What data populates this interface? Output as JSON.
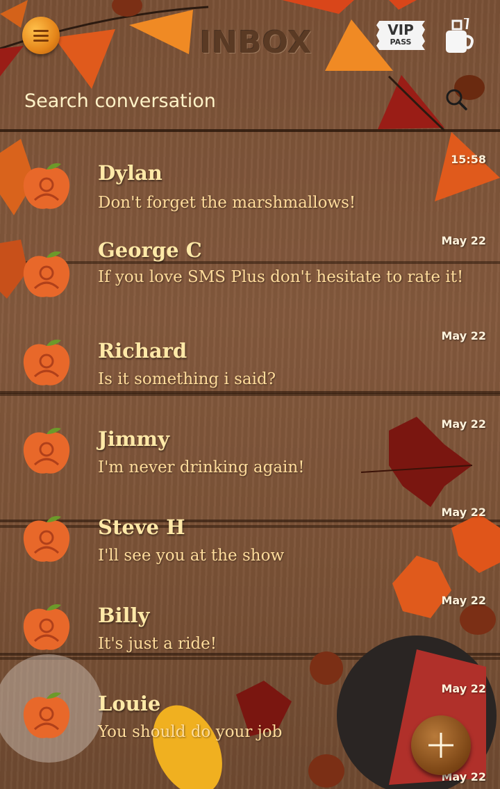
{
  "header": {
    "title": "INBOX",
    "vip_top": "VIP",
    "vip_bottom": "PASS",
    "search_placeholder": "Search conversation"
  },
  "icons": {
    "menu": "menu-icon",
    "vip": "vip-pass-icon",
    "theme": "coffee-cup-icon",
    "search": "search-icon",
    "compose": "plus-icon"
  },
  "colors": {
    "name": "#ffe9a8",
    "message": "#ffdc9c",
    "accent": "#e5861a",
    "wood": "#7a5136"
  },
  "conversations": [
    {
      "name": "Dylan",
      "message": "Don't forget the marshmallows!",
      "time": "15:58"
    },
    {
      "name": "George C",
      "message": "If you love SMS Plus don't hesitate to rate it!",
      "time": "May 22"
    },
    {
      "name": "Richard",
      "message": "Is it something i said?",
      "time": "May 22"
    },
    {
      "name": "Jimmy",
      "message": "I'm never drinking again!",
      "time": "May 22"
    },
    {
      "name": "Steve H",
      "message": "I'll see you at the show",
      "time": "May 22"
    },
    {
      "name": "Billy",
      "message": "It's just a ride!",
      "time": "May 22"
    },
    {
      "name": "Louie",
      "message": "You should do your job",
      "time": "May 22"
    },
    {
      "name": "",
      "message": "",
      "time": "May 22"
    }
  ]
}
